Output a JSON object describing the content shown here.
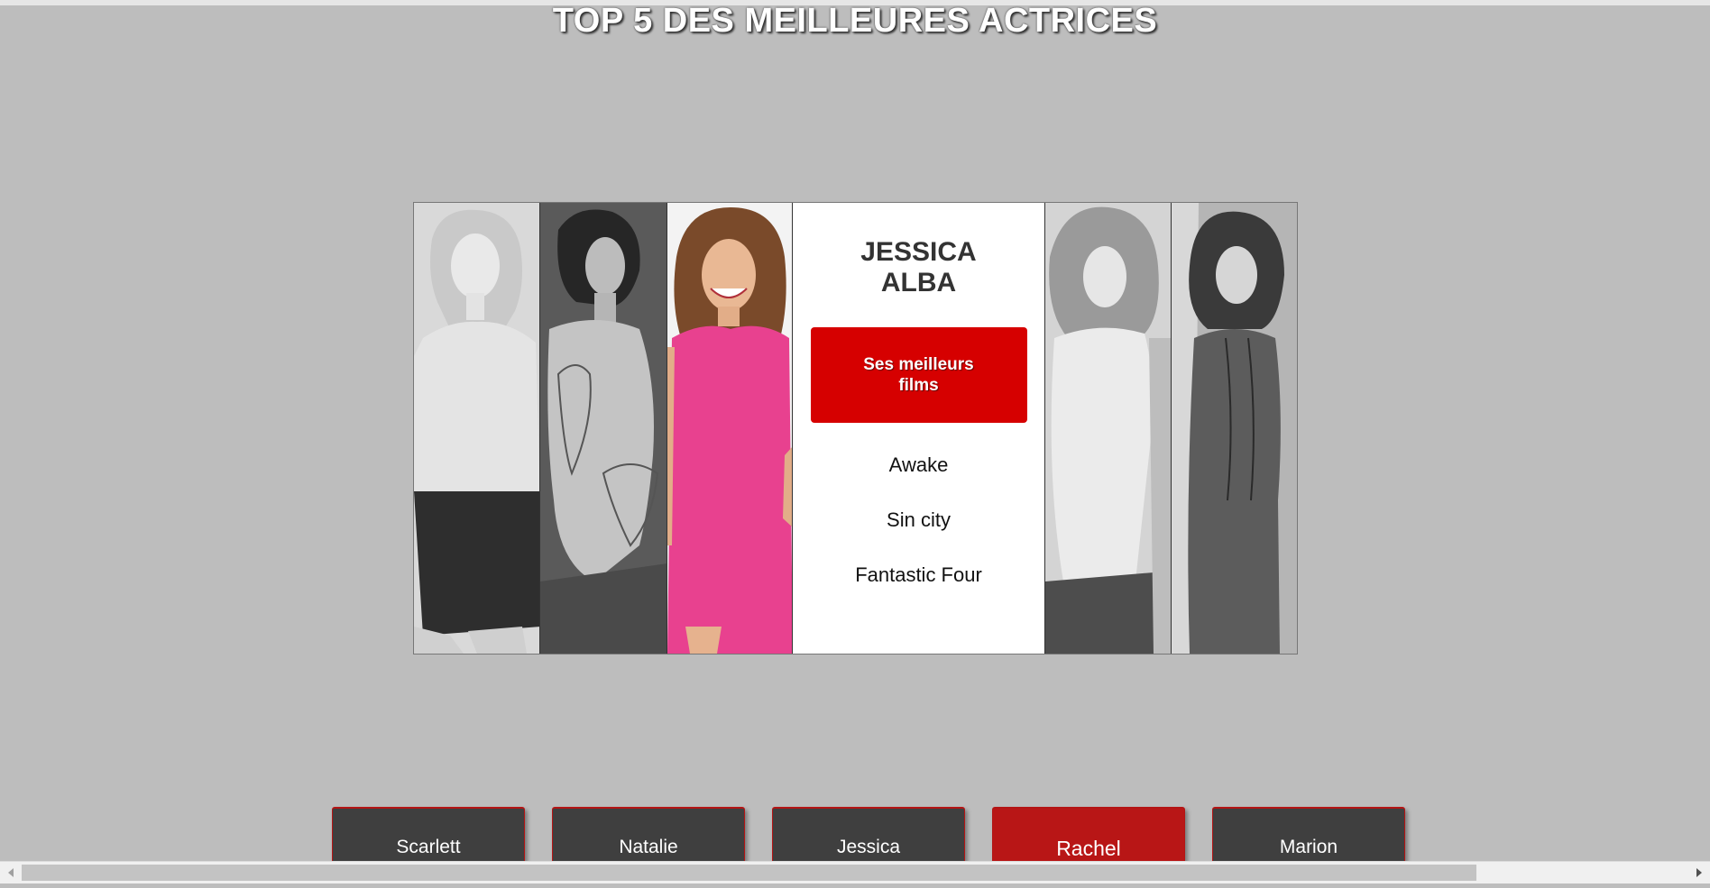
{
  "page": {
    "title": "TOP 5 DES MEILLEURES ACTRICES"
  },
  "featured": {
    "name": "JESSICA ALBA",
    "films_button": "Ses meilleurs films",
    "films": [
      "Awake",
      "Sin city",
      "Fantastic Four"
    ]
  },
  "nav": {
    "buttons": [
      {
        "label": "Scarlett",
        "active": false
      },
      {
        "label": "Natalie",
        "active": false
      },
      {
        "label": "Jessica",
        "active": false
      },
      {
        "label": "Rachel",
        "active": true
      },
      {
        "label": "Marion",
        "active": false
      }
    ]
  },
  "colors": {
    "background": "#bdbdbd",
    "accent": "#d60000",
    "nav_button": "#3f3f3f",
    "nav_active": "#b81616",
    "dress_pink": "#e8418f"
  },
  "icons": {
    "scroll_left": "triangle-left-icon",
    "scroll_right": "triangle-right-icon"
  }
}
